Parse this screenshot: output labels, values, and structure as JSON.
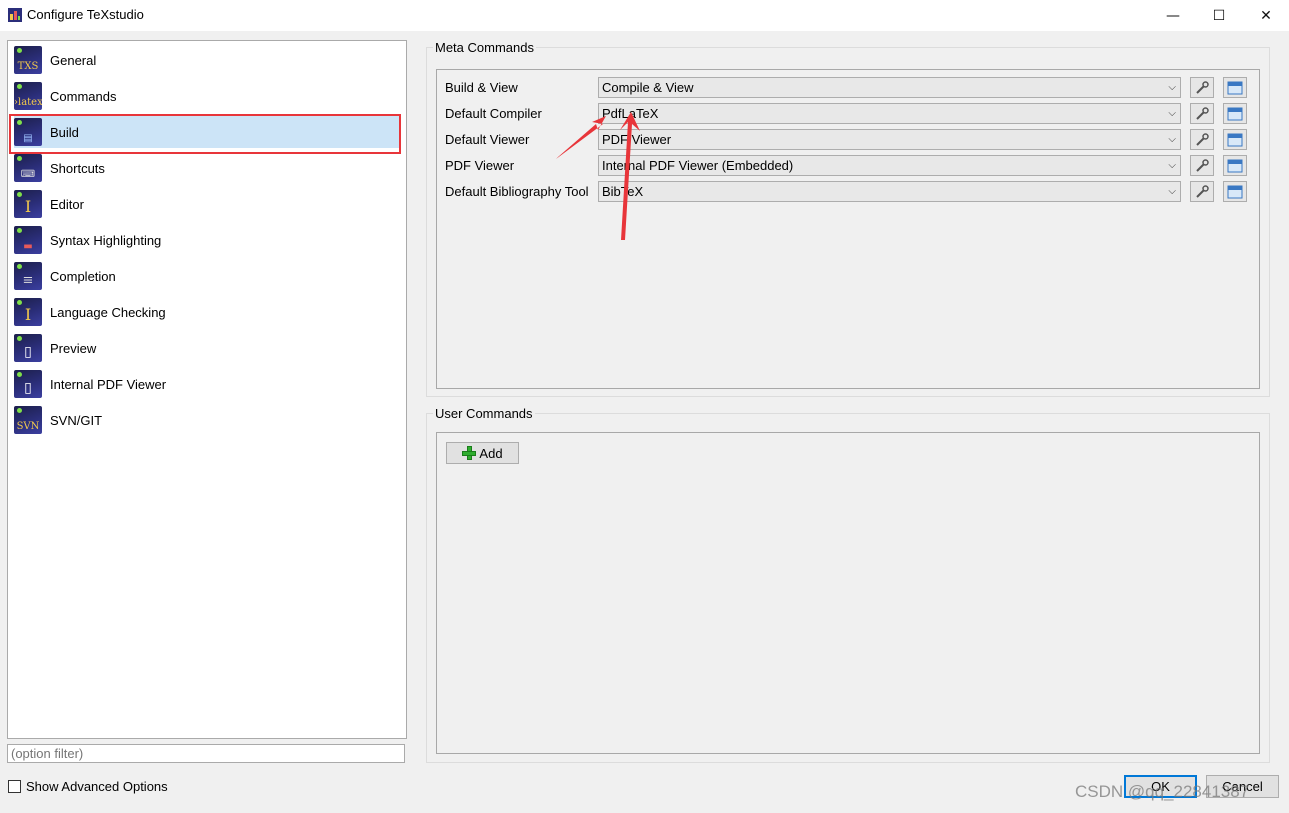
{
  "window": {
    "title": "Configure TeXstudio",
    "minimize_glyph": "—",
    "maximize_glyph": "☐",
    "close_glyph": "✕"
  },
  "sidebar": {
    "items": [
      {
        "label": "General",
        "icon": "txs-general-icon",
        "glyph": "TXS"
      },
      {
        "label": "Commands",
        "icon": "latex-commands-icon",
        "glyph": "›latex"
      },
      {
        "label": "Build",
        "icon": "build-icon",
        "glyph": "▤",
        "selected": true
      },
      {
        "label": "Shortcuts",
        "icon": "keyboard-shortcuts-icon",
        "glyph": "⌨"
      },
      {
        "label": "Editor",
        "icon": "text-cursor-editor-icon",
        "glyph": "I"
      },
      {
        "label": "Syntax Highlighting",
        "icon": "syntax-highlighting-icon",
        "glyph": "▬"
      },
      {
        "label": "Completion",
        "icon": "completion-icon",
        "glyph": "≡"
      },
      {
        "label": "Language Checking",
        "icon": "language-checking-icon",
        "glyph": "I"
      },
      {
        "label": "Preview",
        "icon": "preview-document-icon",
        "glyph": "▯"
      },
      {
        "label": "Internal PDF Viewer",
        "icon": "pdf-viewer-icon",
        "glyph": "▯"
      },
      {
        "label": "SVN/GIT",
        "icon": "svn-git-icon",
        "glyph": "SVN"
      }
    ],
    "filter_placeholder": "(option filter)",
    "show_advanced_label": "Show Advanced Options"
  },
  "meta_commands": {
    "title": "Meta Commands",
    "rows": [
      {
        "label": "Build & View",
        "value": "Compile & View"
      },
      {
        "label": "Default Compiler",
        "value": "PdfLaTeX"
      },
      {
        "label": "Default Viewer",
        "value": "PDF Viewer"
      },
      {
        "label": "PDF Viewer",
        "value": "Internal PDF Viewer (Embedded)"
      },
      {
        "label": "Default Bibliography Tool",
        "value": "BibTeX"
      }
    ]
  },
  "user_commands": {
    "title": "User Commands",
    "add_label": "Add"
  },
  "dialog_buttons": {
    "ok_label": "OK",
    "cancel_label": "Cancel"
  },
  "watermark": "CSDN @qq_22841387",
  "colors": {
    "selection": "#cce4f7",
    "annotation_red": "#e8353a",
    "ok_border": "#0078d7"
  }
}
